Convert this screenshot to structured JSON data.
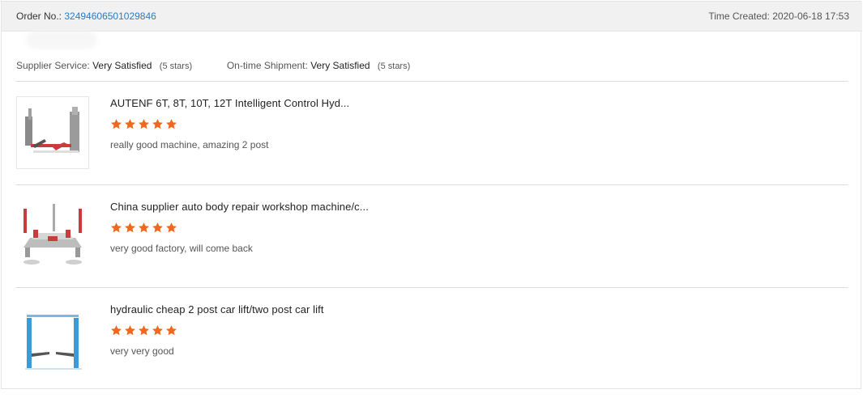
{
  "header": {
    "order_label": "Order No.:",
    "order_number": "3249460650102984​6",
    "time_label": "Time Created:",
    "time_value": "2020-06-18 17:53"
  },
  "ratings": {
    "supplier_label": "Supplier Service:",
    "supplier_value": "Very Satisfied",
    "supplier_stars": "(5 stars)",
    "shipment_label": "On-time Shipment:",
    "shipment_value": "Very Satisfied",
    "shipment_stars": "(5 stars)"
  },
  "star_color": "#f0681e",
  "items": [
    {
      "title": "AUTENF 6T, 8T, 10T, 12T Intelligent Control Hyd...",
      "rating": 5,
      "comment": "really good machine, amazing 2 post",
      "icon": "auto-body-frame-machine-icon"
    },
    {
      "title": "China supplier auto body repair workshop machine/c...",
      "rating": 5,
      "comment": "very good factory, will come back",
      "icon": "car-bench-frame-icon"
    },
    {
      "title": "hydraulic cheap 2 post car lift/two post car lift",
      "rating": 5,
      "comment": "very very good",
      "icon": "two-post-car-lift-icon"
    }
  ]
}
